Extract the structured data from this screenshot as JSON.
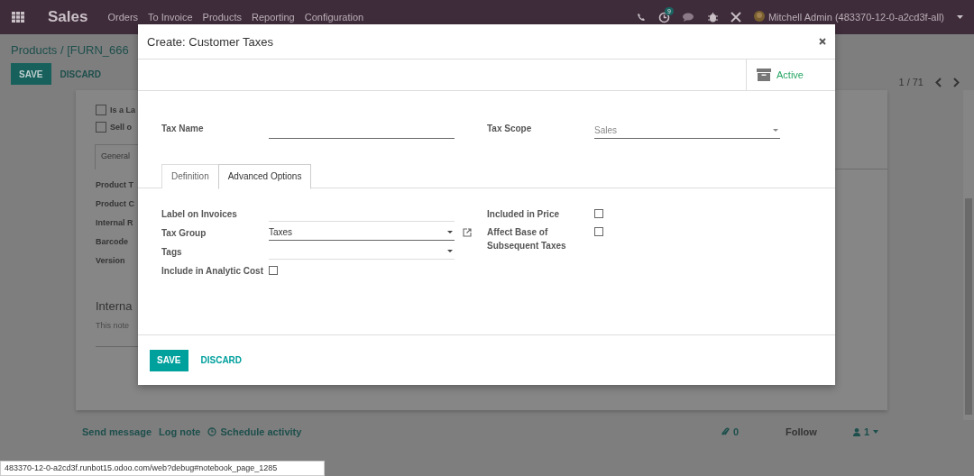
{
  "navbar": {
    "app": "Sales",
    "menu": [
      "Orders",
      "To Invoice",
      "Products",
      "Reporting",
      "Configuration"
    ],
    "activity_badge": "9",
    "user": "Mitchell Admin (483370-12-0-a2cd3f-all)"
  },
  "control_panel": {
    "breadcrumb": "Products / [FURN_666",
    "buttons": [
      {
        "label": "SAVE",
        "kind": "primary"
      },
      {
        "label": "DISCARD",
        "kind": "link"
      }
    ],
    "pager": "1 / 71"
  },
  "sheet": {
    "checkboxes": [
      {
        "label": "Is a La",
        "checked": false
      },
      {
        "label": "Sell o",
        "checked": false
      }
    ],
    "tab": "General",
    "fields": [
      "Product T",
      "Product C",
      "Internal R",
      "Barcode",
      "Version"
    ],
    "section": "Interna",
    "note_placeholder": "This note"
  },
  "chatter": {
    "actions": [
      "Send message",
      "Log note",
      "Schedule activity"
    ],
    "attachments": "0",
    "follow": "Follow",
    "followers": "1"
  },
  "status_url": "483370-12-0-a2cd3f.runbot15.odoo.com/web?debug#notebook_page_1285",
  "dialog": {
    "title": "Create: Customer Taxes",
    "active_button": "Active",
    "tax_name": {
      "label": "Tax Name"
    },
    "tax_scope": {
      "label": "Tax Scope",
      "value": "Sales"
    },
    "tabs": [
      {
        "label": "Definition",
        "selected": false
      },
      {
        "label": "Advanced Options",
        "selected": true
      }
    ],
    "left_fields": [
      {
        "kind": "text",
        "label": "Label on Invoices"
      },
      {
        "kind": "select",
        "label": "Tax Group",
        "value": "Taxes",
        "external_link": true
      },
      {
        "kind": "select",
        "label": "Tags"
      },
      {
        "kind": "checkbox",
        "label": "Include in Analytic Cost",
        "checked": false
      }
    ],
    "right_fields": [
      {
        "kind": "checkbox",
        "label": "Included in Price",
        "checked": false
      },
      {
        "kind": "checkbox",
        "label": "Affect Base of Subsequent Taxes",
        "checked": false
      }
    ],
    "buttons": [
      {
        "label": "SAVE",
        "kind": "primary"
      },
      {
        "label": "DISCARD",
        "kind": "link"
      }
    ]
  }
}
